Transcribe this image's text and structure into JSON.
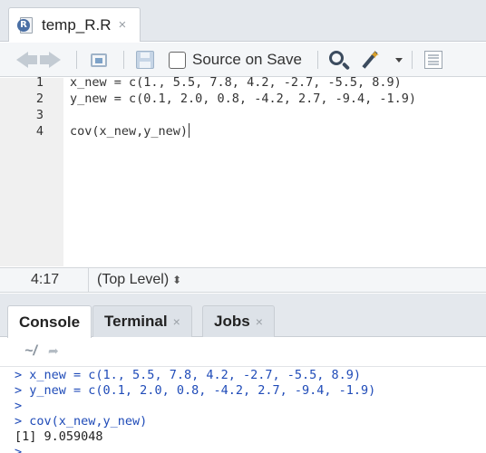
{
  "editor_tab": {
    "filename": "temp_R.R",
    "close": "×"
  },
  "toolbar": {
    "source_on_save_label": "Source on Save",
    "source_on_save_checked": false
  },
  "editor": {
    "lines": [
      {
        "num": "1",
        "code": "x_new = c(1., 5.5, 7.8, 4.2, -2.7, -5.5, 8.9)"
      },
      {
        "num": "2",
        "code": "y_new = c(0.1, 2.0, 0.8, -4.2, 2.7, -9.4, -1.9)"
      },
      {
        "num": "3",
        "code": ""
      },
      {
        "num": "4",
        "code": "cov(x_new,y_new)"
      }
    ]
  },
  "status": {
    "cursor_position": "4:17",
    "scope": "(Top Level)",
    "scope_caret": "⬍"
  },
  "console_tabs": [
    {
      "label": "Console",
      "active": true
    },
    {
      "label": "Terminal",
      "close": "×"
    },
    {
      "label": "Jobs",
      "close": "×"
    }
  ],
  "console": {
    "working_dir": "~/",
    "lines": [
      {
        "prompt": ">",
        "text": " x_new = c(1., 5.5, 7.8, 4.2, -2.7, -5.5, 8.9)"
      },
      {
        "prompt": ">",
        "text": " y_new = c(0.1, 2.0, 0.8, -4.2, 2.7, -9.4, -1.9)"
      },
      {
        "prompt": ">",
        "text": ""
      },
      {
        "prompt": ">",
        "text": " cov(x_new,y_new)"
      },
      {
        "output": "[1] 9.059048"
      },
      {
        "prompt": ">",
        "text": ""
      }
    ]
  },
  "colors": {
    "prompt": "#1f4bb8",
    "tabbar_bg": "#e4e8ed",
    "gutter_bg": "#f0f0f0"
  }
}
